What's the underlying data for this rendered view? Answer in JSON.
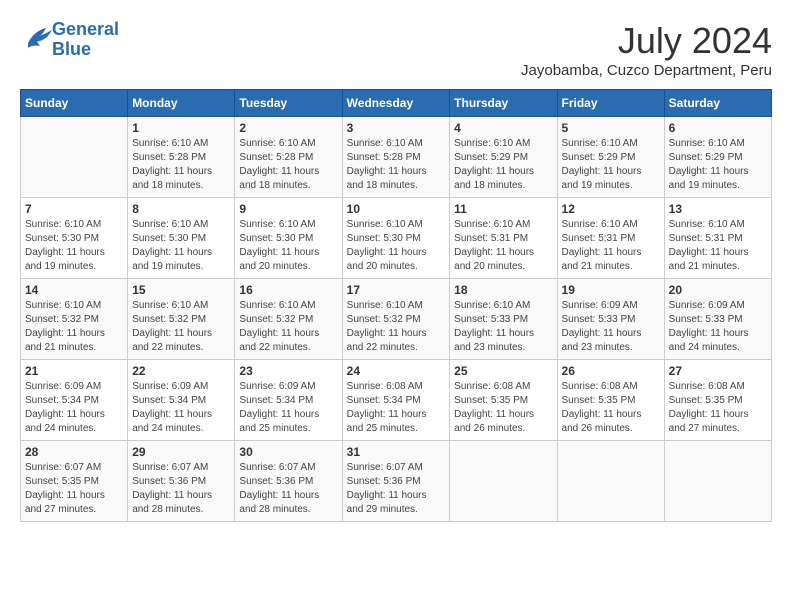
{
  "logo": {
    "line1": "General",
    "line2": "Blue"
  },
  "title": "July 2024",
  "location": "Jayobamba, Cuzco Department, Peru",
  "headers": [
    "Sunday",
    "Monday",
    "Tuesday",
    "Wednesday",
    "Thursday",
    "Friday",
    "Saturday"
  ],
  "weeks": [
    [
      {
        "day": "",
        "sunrise": "",
        "sunset": "",
        "daylight": ""
      },
      {
        "day": "1",
        "sunrise": "Sunrise: 6:10 AM",
        "sunset": "Sunset: 5:28 PM",
        "daylight": "Daylight: 11 hours and 18 minutes."
      },
      {
        "day": "2",
        "sunrise": "Sunrise: 6:10 AM",
        "sunset": "Sunset: 5:28 PM",
        "daylight": "Daylight: 11 hours and 18 minutes."
      },
      {
        "day": "3",
        "sunrise": "Sunrise: 6:10 AM",
        "sunset": "Sunset: 5:28 PM",
        "daylight": "Daylight: 11 hours and 18 minutes."
      },
      {
        "day": "4",
        "sunrise": "Sunrise: 6:10 AM",
        "sunset": "Sunset: 5:29 PM",
        "daylight": "Daylight: 11 hours and 18 minutes."
      },
      {
        "day": "5",
        "sunrise": "Sunrise: 6:10 AM",
        "sunset": "Sunset: 5:29 PM",
        "daylight": "Daylight: 11 hours and 19 minutes."
      },
      {
        "day": "6",
        "sunrise": "Sunrise: 6:10 AM",
        "sunset": "Sunset: 5:29 PM",
        "daylight": "Daylight: 11 hours and 19 minutes."
      }
    ],
    [
      {
        "day": "7",
        "sunrise": "Sunrise: 6:10 AM",
        "sunset": "Sunset: 5:30 PM",
        "daylight": "Daylight: 11 hours and 19 minutes."
      },
      {
        "day": "8",
        "sunrise": "Sunrise: 6:10 AM",
        "sunset": "Sunset: 5:30 PM",
        "daylight": "Daylight: 11 hours and 19 minutes."
      },
      {
        "day": "9",
        "sunrise": "Sunrise: 6:10 AM",
        "sunset": "Sunset: 5:30 PM",
        "daylight": "Daylight: 11 hours and 20 minutes."
      },
      {
        "day": "10",
        "sunrise": "Sunrise: 6:10 AM",
        "sunset": "Sunset: 5:30 PM",
        "daylight": "Daylight: 11 hours and 20 minutes."
      },
      {
        "day": "11",
        "sunrise": "Sunrise: 6:10 AM",
        "sunset": "Sunset: 5:31 PM",
        "daylight": "Daylight: 11 hours and 20 minutes."
      },
      {
        "day": "12",
        "sunrise": "Sunrise: 6:10 AM",
        "sunset": "Sunset: 5:31 PM",
        "daylight": "Daylight: 11 hours and 21 minutes."
      },
      {
        "day": "13",
        "sunrise": "Sunrise: 6:10 AM",
        "sunset": "Sunset: 5:31 PM",
        "daylight": "Daylight: 11 hours and 21 minutes."
      }
    ],
    [
      {
        "day": "14",
        "sunrise": "Sunrise: 6:10 AM",
        "sunset": "Sunset: 5:32 PM",
        "daylight": "Daylight: 11 hours and 21 minutes."
      },
      {
        "day": "15",
        "sunrise": "Sunrise: 6:10 AM",
        "sunset": "Sunset: 5:32 PM",
        "daylight": "Daylight: 11 hours and 22 minutes."
      },
      {
        "day": "16",
        "sunrise": "Sunrise: 6:10 AM",
        "sunset": "Sunset: 5:32 PM",
        "daylight": "Daylight: 11 hours and 22 minutes."
      },
      {
        "day": "17",
        "sunrise": "Sunrise: 6:10 AM",
        "sunset": "Sunset: 5:32 PM",
        "daylight": "Daylight: 11 hours and 22 minutes."
      },
      {
        "day": "18",
        "sunrise": "Sunrise: 6:10 AM",
        "sunset": "Sunset: 5:33 PM",
        "daylight": "Daylight: 11 hours and 23 minutes."
      },
      {
        "day": "19",
        "sunrise": "Sunrise: 6:09 AM",
        "sunset": "Sunset: 5:33 PM",
        "daylight": "Daylight: 11 hours and 23 minutes."
      },
      {
        "day": "20",
        "sunrise": "Sunrise: 6:09 AM",
        "sunset": "Sunset: 5:33 PM",
        "daylight": "Daylight: 11 hours and 24 minutes."
      }
    ],
    [
      {
        "day": "21",
        "sunrise": "Sunrise: 6:09 AM",
        "sunset": "Sunset: 5:34 PM",
        "daylight": "Daylight: 11 hours and 24 minutes."
      },
      {
        "day": "22",
        "sunrise": "Sunrise: 6:09 AM",
        "sunset": "Sunset: 5:34 PM",
        "daylight": "Daylight: 11 hours and 24 minutes."
      },
      {
        "day": "23",
        "sunrise": "Sunrise: 6:09 AM",
        "sunset": "Sunset: 5:34 PM",
        "daylight": "Daylight: 11 hours and 25 minutes."
      },
      {
        "day": "24",
        "sunrise": "Sunrise: 6:08 AM",
        "sunset": "Sunset: 5:34 PM",
        "daylight": "Daylight: 11 hours and 25 minutes."
      },
      {
        "day": "25",
        "sunrise": "Sunrise: 6:08 AM",
        "sunset": "Sunset: 5:35 PM",
        "daylight": "Daylight: 11 hours and 26 minutes."
      },
      {
        "day": "26",
        "sunrise": "Sunrise: 6:08 AM",
        "sunset": "Sunset: 5:35 PM",
        "daylight": "Daylight: 11 hours and 26 minutes."
      },
      {
        "day": "27",
        "sunrise": "Sunrise: 6:08 AM",
        "sunset": "Sunset: 5:35 PM",
        "daylight": "Daylight: 11 hours and 27 minutes."
      }
    ],
    [
      {
        "day": "28",
        "sunrise": "Sunrise: 6:07 AM",
        "sunset": "Sunset: 5:35 PM",
        "daylight": "Daylight: 11 hours and 27 minutes."
      },
      {
        "day": "29",
        "sunrise": "Sunrise: 6:07 AM",
        "sunset": "Sunset: 5:36 PM",
        "daylight": "Daylight: 11 hours and 28 minutes."
      },
      {
        "day": "30",
        "sunrise": "Sunrise: 6:07 AM",
        "sunset": "Sunset: 5:36 PM",
        "daylight": "Daylight: 11 hours and 28 minutes."
      },
      {
        "day": "31",
        "sunrise": "Sunrise: 6:07 AM",
        "sunset": "Sunset: 5:36 PM",
        "daylight": "Daylight: 11 hours and 29 minutes."
      },
      {
        "day": "",
        "sunrise": "",
        "sunset": "",
        "daylight": ""
      },
      {
        "day": "",
        "sunrise": "",
        "sunset": "",
        "daylight": ""
      },
      {
        "day": "",
        "sunrise": "",
        "sunset": "",
        "daylight": ""
      }
    ]
  ]
}
